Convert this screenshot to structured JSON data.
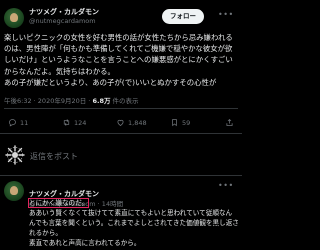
{
  "tweet": {
    "author_name": "ナツメグ・カルダモン",
    "author_handle": "@nutmegcardamom",
    "follow_label": "フォロー",
    "more_label": "•••",
    "lines": [
      "楽しいピクニックの女性を好む男性の話が女性たちから忌み嫌われる",
      "のは、男性陣が「何もかも準備してくれてご機嫌で穏やかな彼女が欲",
      "しいだけ」というようなことを言うことへの嫌悪感がとにかくすごい",
      "からなんだよ。気持ちはわかる。",
      "あの子が嫌だというより、あの子が(で)いいとぬかすその心性が"
    ],
    "timestamp": "午後6:32 · 2020年9月20日 · ",
    "views": "6.8万",
    "views_suffix": " 件の表示"
  },
  "actions": {
    "reply_count": "11",
    "retweet_count": "124",
    "like_count": "1,848",
    "bookmark_count": "59"
  },
  "composer": {
    "placeholder": "返信をポスト"
  },
  "reply": {
    "author_name": "ナツメグ・カルダモン",
    "author_handle": "@nutmegcardamom",
    "time": " · 14時間",
    "more_label": "•••",
    "highlighted": "とにかく嫌なのだ。",
    "lines": [
      "ああいう賢くなくて抜けてて素直にてもよいと思われていて従順なん",
      "んでも言葉を聞くという。これまでよしとされてきた価値観を黒し返さ",
      "れるから。",
      "素直であれと声高に言われてるから。"
    ]
  },
  "colors": {
    "background": "#000000",
    "text": "#e7e9ea",
    "muted": "#71767b",
    "highlight_box": "#e0245e"
  }
}
